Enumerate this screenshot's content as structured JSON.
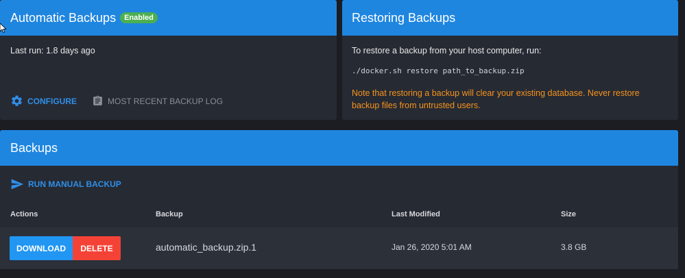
{
  "auto_backups": {
    "title": "Automatic Backups",
    "badge": "Enabled",
    "last_run": "Last run: 1.8 days ago",
    "configure_label": "CONFIGURE",
    "log_label": "MOST RECENT BACKUP LOG"
  },
  "restoring": {
    "title": "Restoring Backups",
    "instruction": "To restore a backup from your host computer, run:",
    "command": "./docker.sh restore path_to_backup.zip",
    "warning": "Note that restoring a backup will clear your existing database. Never restore backup files from untrusted users."
  },
  "backups": {
    "title": "Backups",
    "manual_label": "RUN MANUAL BACKUP",
    "columns": [
      "Actions",
      "Backup",
      "Last Modified",
      "Size"
    ],
    "rows": [
      {
        "download_label": "DOWNLOAD",
        "delete_label": "DELETE",
        "file": "automatic_backup.zip.1",
        "modified": "Jan 26, 2020 5:01 AM",
        "size": "3.8 GB"
      }
    ]
  },
  "colors": {
    "header": "#1f86e0",
    "background": "#1b1d22",
    "card": "#262a33",
    "enabled_badge": "#4caf50",
    "warning": "#f7941d",
    "download": "#2196f3",
    "delete": "#f44336"
  },
  "icons": [
    "gear-icon",
    "clipboard-icon",
    "send-icon",
    "cursor-icon"
  ]
}
